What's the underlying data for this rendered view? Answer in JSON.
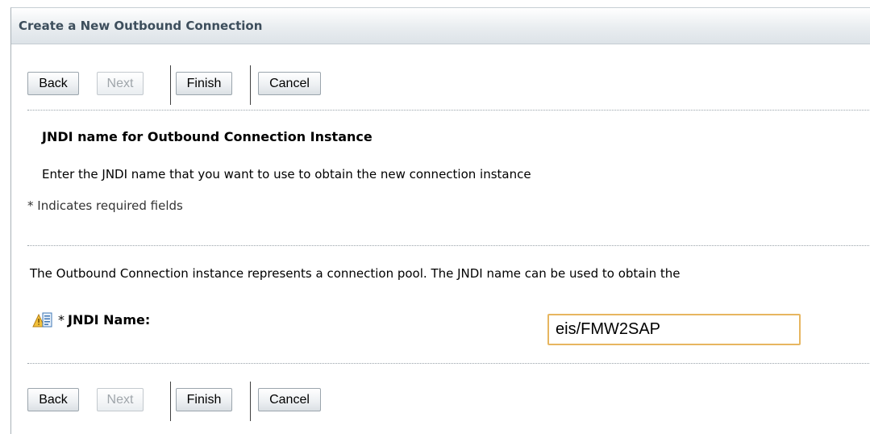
{
  "page": {
    "title": "Create a New Outbound Connection"
  },
  "toolbar_top": {
    "back_label": "Back",
    "next_label": "Next",
    "finish_label": "Finish",
    "cancel_label": "Cancel",
    "next_disabled": true
  },
  "section": {
    "heading": "JNDI name for Outbound Connection Instance",
    "instruction": "Enter the JNDI name that you want to use to obtain the new connection instance",
    "required_note": "* Indicates required fields",
    "description": "The Outbound Connection instance represents a connection pool. The JNDI name can be used to obtain the"
  },
  "jndi_field": {
    "required_marker": "*",
    "label": "JNDI Name:",
    "value": "eis/FMW2SAP",
    "icon": "warning-help-icon"
  },
  "toolbar_bottom": {
    "back_label": "Back",
    "next_label": "Next",
    "finish_label": "Finish",
    "cancel_label": "Cancel",
    "next_disabled": true
  },
  "colors": {
    "title_text": "#3d4e5c",
    "input_focus_border": "#e7b660",
    "disabled_text": "#a0a6ab"
  }
}
